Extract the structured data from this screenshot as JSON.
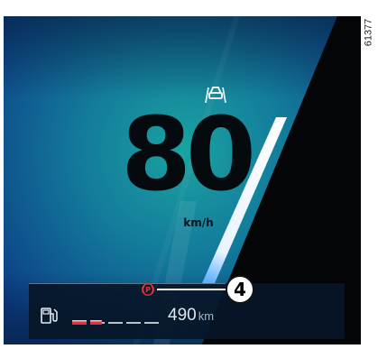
{
  "figure": {
    "reference_code": "61377"
  },
  "cluster": {
    "speed": "80",
    "speed_unit": "km/h",
    "icons": {
      "acc": "adaptive-cruise-control-icon",
      "parking": "parking-brake-icon",
      "fuel": "fuel-pump-icon"
    },
    "callout_label": "4",
    "fuel_level_fraction": 0.35,
    "range_value": "490",
    "range_unit": "km"
  },
  "colors": {
    "display_teal": "#1aa3a1",
    "display_blue": "#0e4a98",
    "dark_navy": "#061a35",
    "warning_red": "#e2343a",
    "road_stripe": "#ffffff",
    "bottom_bar": "#081628"
  }
}
